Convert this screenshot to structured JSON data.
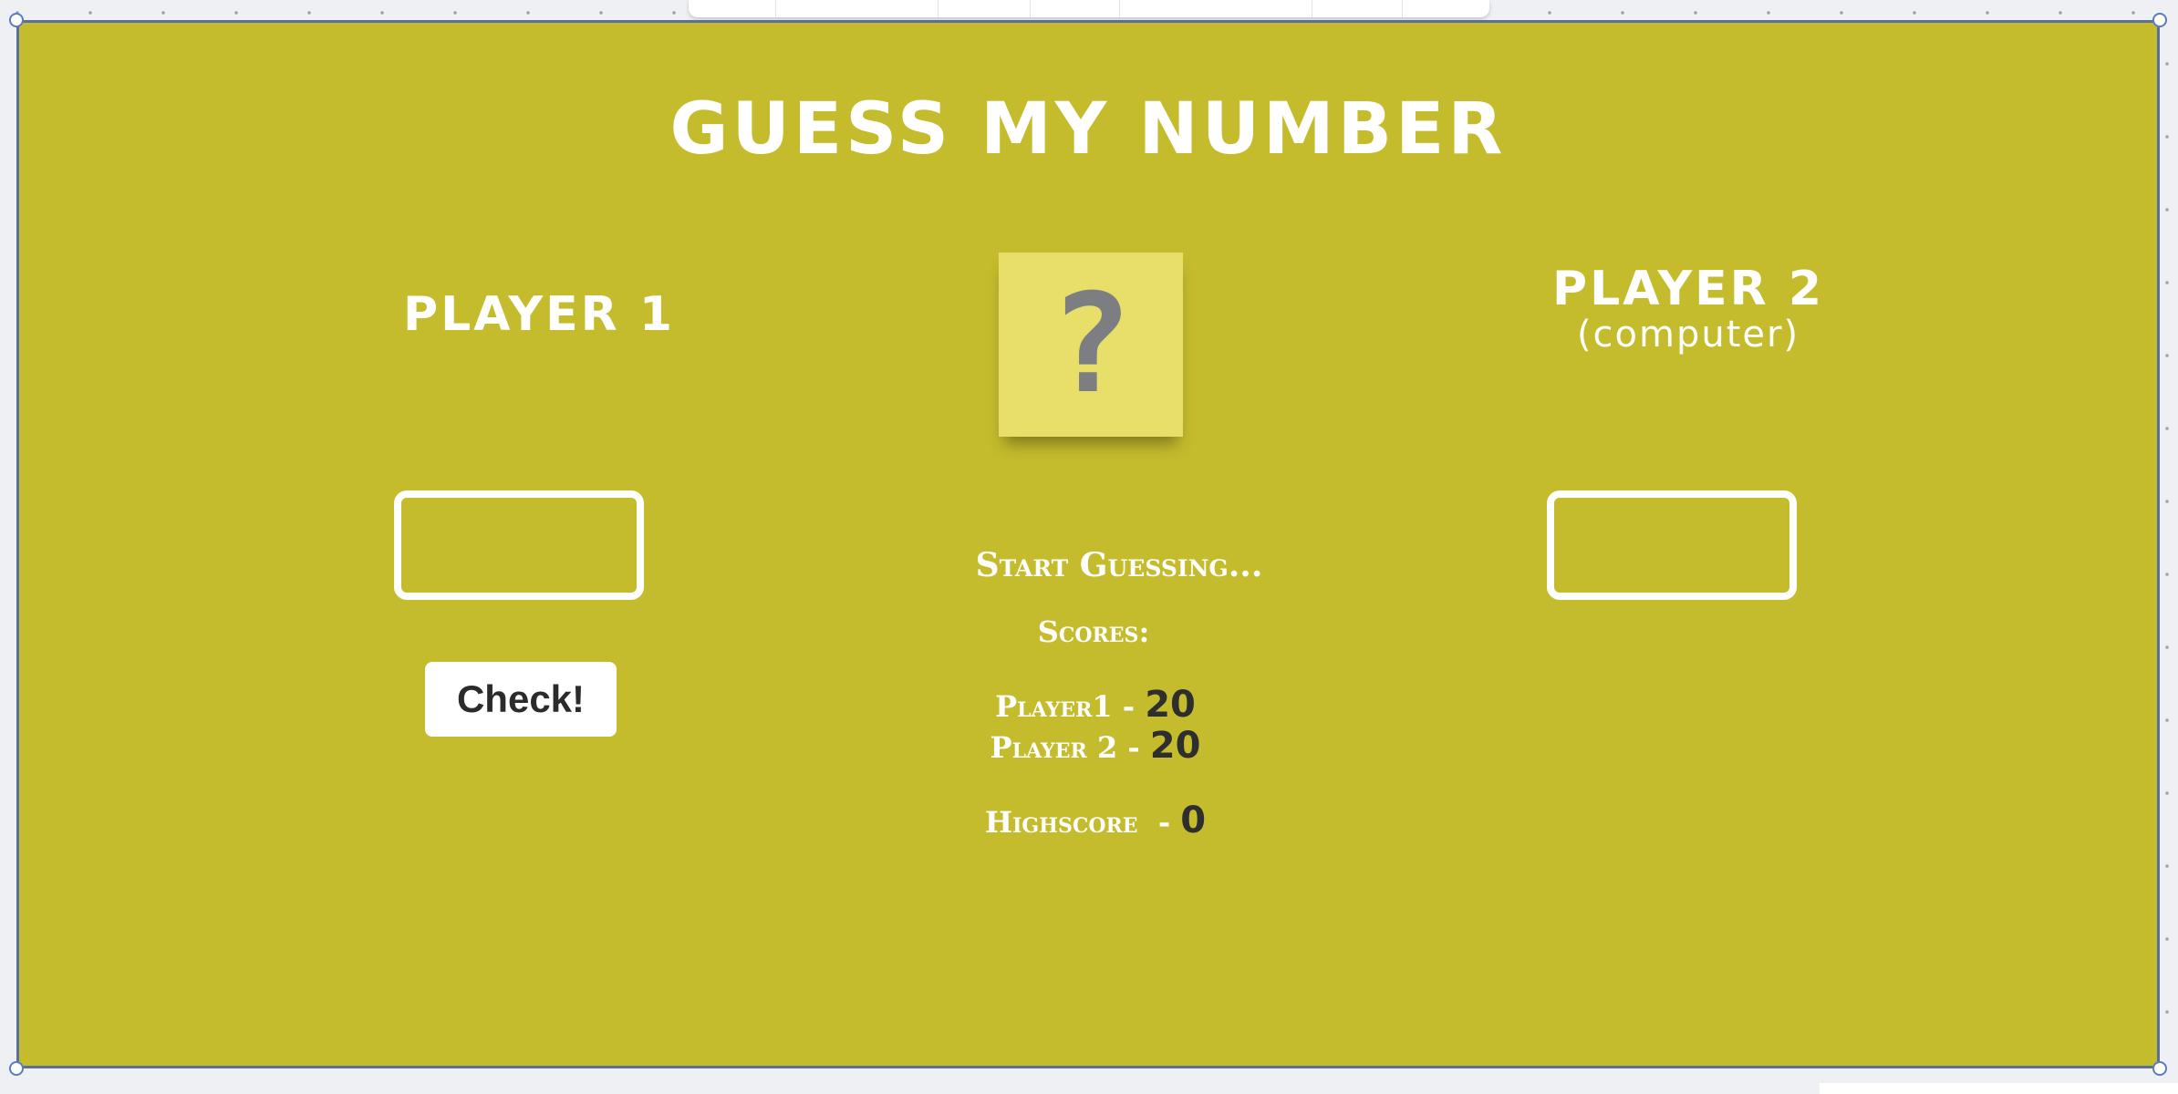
{
  "game": {
    "title": "GUESS MY NUMBER",
    "secret_display": "?",
    "player1": {
      "heading": "PLAYER 1",
      "guess_value": "",
      "check_label": "Check!"
    },
    "player2": {
      "heading": "PLAYER 2",
      "subheading": "(computer)",
      "guess_value": ""
    },
    "status_message": "Start Guessing...",
    "scores": {
      "label": "Scores:",
      "player1_label": "Player1 - ",
      "player1_value": "20",
      "player2_label": "Player 2 - ",
      "player2_value": "20",
      "highscore_label": "Highscore  - ",
      "highscore_value": "0"
    }
  },
  "colors": {
    "background": "#c4bc2d",
    "mystery_box": "#e7df6a",
    "question_mark": "#7d7e82",
    "text": "#ffffff",
    "score_values": "#2e2e2e",
    "frame_border": "#5a6f99"
  }
}
